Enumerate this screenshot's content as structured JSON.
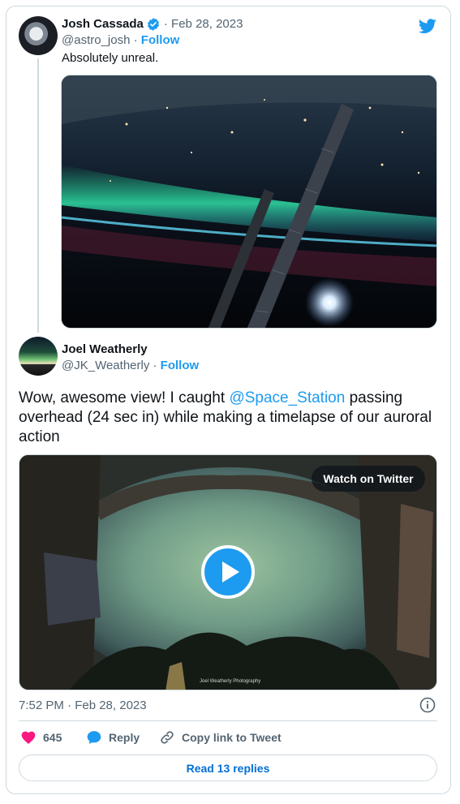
{
  "tweet1": {
    "display_name": "Josh Cassada",
    "date": "· Feb 28, 2023",
    "handle": "@astro_josh",
    "handle_sep": " · ",
    "follow": "Follow",
    "text": "Absolutely unreal."
  },
  "tweet2": {
    "display_name": "Joel Weatherly",
    "handle": "@JK_Weatherly",
    "handle_sep": " · ",
    "follow": "Follow",
    "text_before": "Wow, awesome view! I caught ",
    "mention": "@Space_Station",
    "text_after": " passing overhead (24 sec in) while making a timelapse of our auroral action",
    "watch_label": "Watch on Twitter",
    "video_credit": "Joel Weatherly Photography",
    "timestamp": "7:52 PM · Feb 28, 2023"
  },
  "actions": {
    "like_count": "645",
    "reply_label": "Reply",
    "copy_label": "Copy link to Tweet"
  },
  "read_replies": "Read 13 replies",
  "colors": {
    "accent": "#1d9bf0",
    "like": "#f91880",
    "muted": "#536471",
    "border": "#cfd9de"
  },
  "icons": [
    "twitter-bird-icon",
    "verified-badge-icon",
    "play-icon",
    "info-icon",
    "heart-icon",
    "reply-bubble-icon",
    "link-icon"
  ]
}
